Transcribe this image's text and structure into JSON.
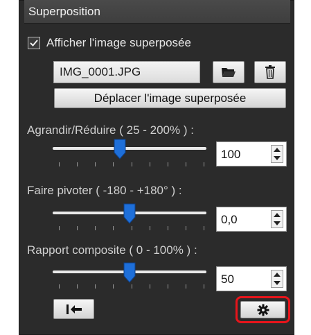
{
  "panel": {
    "title": "Superposition",
    "show_overlay": {
      "checked": true,
      "label": "Afficher l'image superposée"
    },
    "file_name": "IMG_0001.JPG",
    "move_button_label": "Déplacer l'image superposée",
    "zoom": {
      "label": "Agrandir/Réduire ( 25 - 200% ) :",
      "value": "100",
      "fraction": 0.43
    },
    "rotate": {
      "label": "Faire pivoter ( -180 - +180° ) :",
      "value": "0,0",
      "fraction": 0.5
    },
    "opacity": {
      "label": "Rapport composite ( 0 - 100% ) :",
      "value": "50",
      "fraction": 0.5
    }
  },
  "icons": {
    "open": "folder-open-icon",
    "delete": "trash-icon",
    "reset": "reset-icon",
    "settings": "gear-icon"
  },
  "colors": {
    "panel_bg": "#2b2b2b",
    "highlight": "#e8141b",
    "thumb": "#1e6fd9"
  }
}
